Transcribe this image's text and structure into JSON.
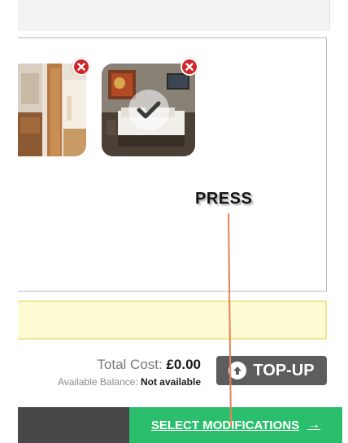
{
  "annotation": {
    "text": "PRESS"
  },
  "gallery": {
    "photos": [
      {
        "name": "interior-photo",
        "selected": false
      },
      {
        "name": "bedroom-photo",
        "selected": true
      }
    ]
  },
  "summary": {
    "total_cost_label": "Total Cost:",
    "total_cost_value": "£0.00",
    "balance_label": "Available Balance:",
    "balance_value": "Not available"
  },
  "buttons": {
    "topup_label": "TOP-UP",
    "select_label": "SELECT MODIFICATIONS",
    "select_arrow": "→"
  },
  "icons": {
    "remove": "close-icon",
    "selected": "checkmark-icon",
    "topup": "arrow-up-circle-icon",
    "next": "arrow-right-icon"
  },
  "colors": {
    "accent_green": "#2bbf6d",
    "remove_red": "#d0262a",
    "topup_gray": "#5d5d5d",
    "notice_yellow": "#fdfbd3",
    "annotation_line": "#e8825a"
  }
}
